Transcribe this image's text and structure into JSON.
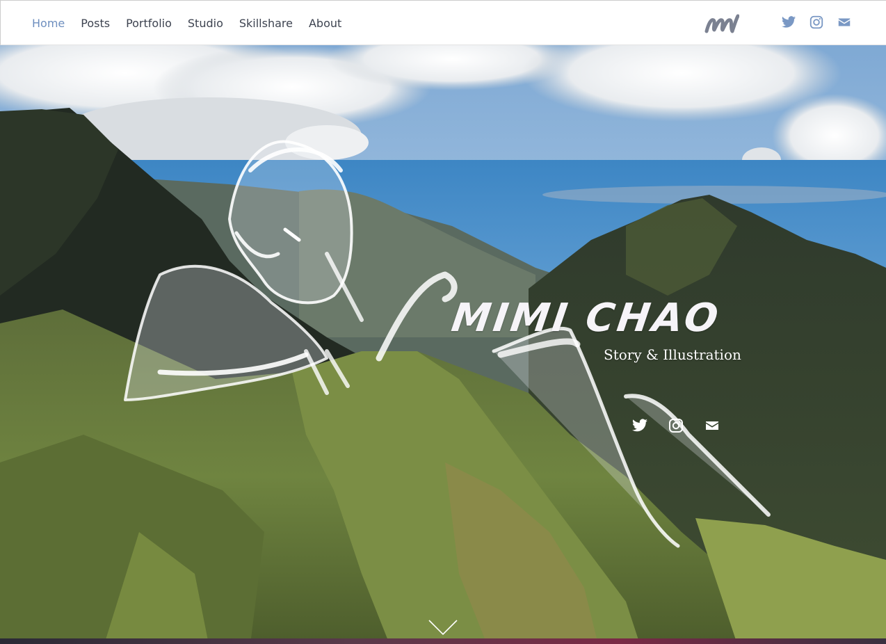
{
  "nav": {
    "items": [
      {
        "label": "Home",
        "active": true
      },
      {
        "label": "Posts",
        "active": false
      },
      {
        "label": "Portfolio",
        "active": false
      },
      {
        "label": "Studio",
        "active": false
      },
      {
        "label": "Skillshare",
        "active": false
      },
      {
        "label": "About",
        "active": false
      }
    ],
    "social_icons": [
      "twitter-icon",
      "instagram-icon",
      "mail-icon"
    ]
  },
  "hero": {
    "title": "MIMI CHAO",
    "subtitle": "Story & Illustration",
    "social_icons": [
      "twitter-icon",
      "instagram-icon",
      "mail-icon"
    ],
    "scroll_icon": "chevron-down-icon"
  },
  "colors": {
    "nav_active": "#6e8fbf",
    "nav_text": "#3d4350",
    "icon_blue": "#7a98c4",
    "hero_text": "#ffffff"
  }
}
